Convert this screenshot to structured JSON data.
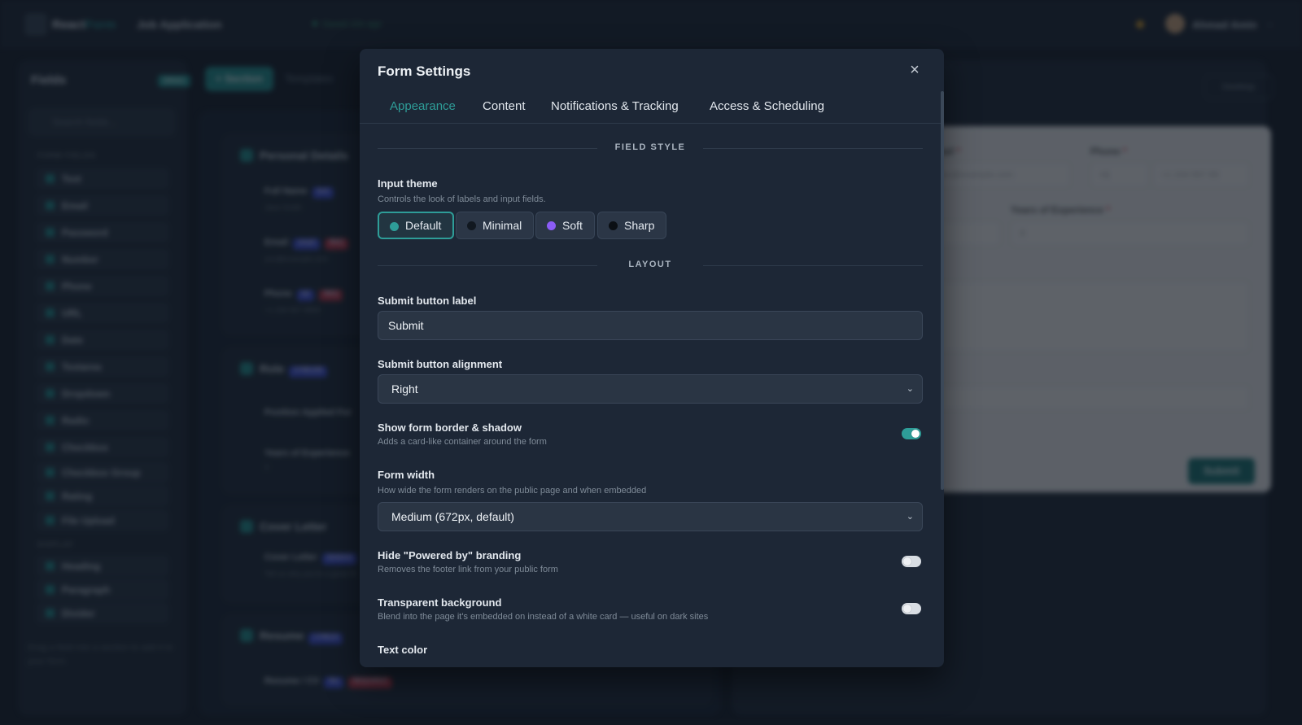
{
  "topbar": {
    "brand_main": "React",
    "brand_accent": "Form",
    "project": "Job Application",
    "saved": "Saved 10s ago",
    "user": "Ahmad Amin"
  },
  "fields_panel": {
    "title": "Fields",
    "drag_badge": "DRAG",
    "search_placeholder": "Search fields...",
    "section_form": "FORM FIELDS",
    "section_display": "DISPLAY",
    "items": [
      "Text",
      "Email",
      "Password",
      "Number",
      "Phone",
      "URL",
      "Date",
      "Textarea",
      "Dropdown",
      "Radio",
      "Checkbox",
      "Checkbox Group",
      "Rating",
      "File Upload"
    ],
    "display_items": [
      "Heading",
      "Paragraph",
      "Divider"
    ],
    "hint": "Drag a field into a section to add it to your form."
  },
  "builder": {
    "section_button": "+ Section",
    "templates": "Templates",
    "sections": [
      {
        "title": "Personal Details"
      },
      {
        "title": "Role",
        "badge": "2 FIELDS"
      },
      {
        "title": "Cover Letter"
      },
      {
        "title": "Resume",
        "badge": "1 FIELD"
      }
    ],
    "rows": [
      {
        "label": "Full Name",
        "tag": "text",
        "sub": "Jane Smith"
      },
      {
        "label": "Email",
        "tag": "email",
        "tag2": "REQ",
        "sub": "you@example.com"
      },
      {
        "label": "Phone",
        "tag": "tel",
        "tag2": "REQ",
        "sub": "+1 234 567 8900"
      },
      {
        "label": "Position Applied For"
      },
      {
        "label": "Years of Experience",
        "sub": "3"
      },
      {
        "label": "Cover Letter",
        "tag": "textarea",
        "sub": "Tell us why you're a great fit"
      },
      {
        "label": "Resume / CV",
        "tag": "file",
        "tag2": "REQUIRED"
      }
    ]
  },
  "preview": {
    "device": "Desktop",
    "email_label": "Email",
    "email_placeholder": "you@example.com",
    "phone_label": "Phone",
    "phone_code": "+1",
    "phone_placeholder": "+1 234 567 89",
    "years_label": "Years of Experience",
    "years_value": "3",
    "submit": "Submit"
  },
  "modal": {
    "title": "Form Settings",
    "close_icon": "×",
    "tabs": [
      "Appearance",
      "Content",
      "Notifications & Tracking",
      "Access & Scheduling"
    ],
    "active_tab": "Appearance",
    "field_style_heading": "FIELD STYLE",
    "input_theme_label": "Input theme",
    "input_theme_hint": "Controls the look of labels and input fields.",
    "themes": [
      {
        "label": "Default",
        "color": "#2e9d98",
        "selected": true
      },
      {
        "label": "Minimal",
        "color": "#111820",
        "selected": false
      },
      {
        "label": "Soft",
        "color": "#8b5cf6",
        "selected": false
      },
      {
        "label": "Sharp",
        "color": "#0b0f14",
        "selected": false
      }
    ],
    "layout_heading": "LAYOUT",
    "submit_label_label": "Submit button label",
    "submit_label_value": "Submit",
    "submit_align_label": "Submit button alignment",
    "submit_align_value": "Right",
    "border_label": "Show form border & shadow",
    "border_hint": "Adds a card-like container around the form",
    "border_on": true,
    "width_label": "Form width",
    "width_hint": "How wide the form renders on the public page and when embedded",
    "width_value": "Medium (672px, default)",
    "branding_label": "Hide \"Powered by\" branding",
    "branding_hint": "Removes the footer link from your public form",
    "branding_on": false,
    "transparent_label": "Transparent background",
    "transparent_hint": "Blend into the page it's embedded on instead of a white card — useful on dark sites",
    "transparent_on": false,
    "text_color_label": "Text color"
  }
}
